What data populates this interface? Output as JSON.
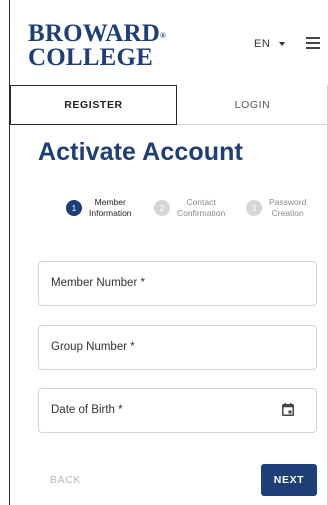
{
  "header": {
    "logo_line1": "BROWARD",
    "logo_mark": "®",
    "logo_line2": "COLLEGE",
    "language": "EN"
  },
  "tabs": [
    {
      "label": "REGISTER",
      "active": true
    },
    {
      "label": "LOGIN",
      "active": false
    }
  ],
  "page_title": "Activate Account",
  "stepper": [
    {
      "number": "1",
      "line1": "Member",
      "line2": "Information",
      "active": true
    },
    {
      "number": "2",
      "line1": "Contact",
      "line2": "Confirmation",
      "active": false
    },
    {
      "number": "3",
      "line1": "Password",
      "line2": "Creation",
      "active": false
    }
  ],
  "form": {
    "member_number_label": "Member Number *",
    "group_number_label": "Group Number *",
    "date_of_birth_label": "Date of Birth *"
  },
  "actions": {
    "back_label": "BACK",
    "next_label": "NEXT"
  },
  "colors": {
    "brand_navy": "#1d3e77",
    "inactive_step": "#d6d6d6"
  }
}
